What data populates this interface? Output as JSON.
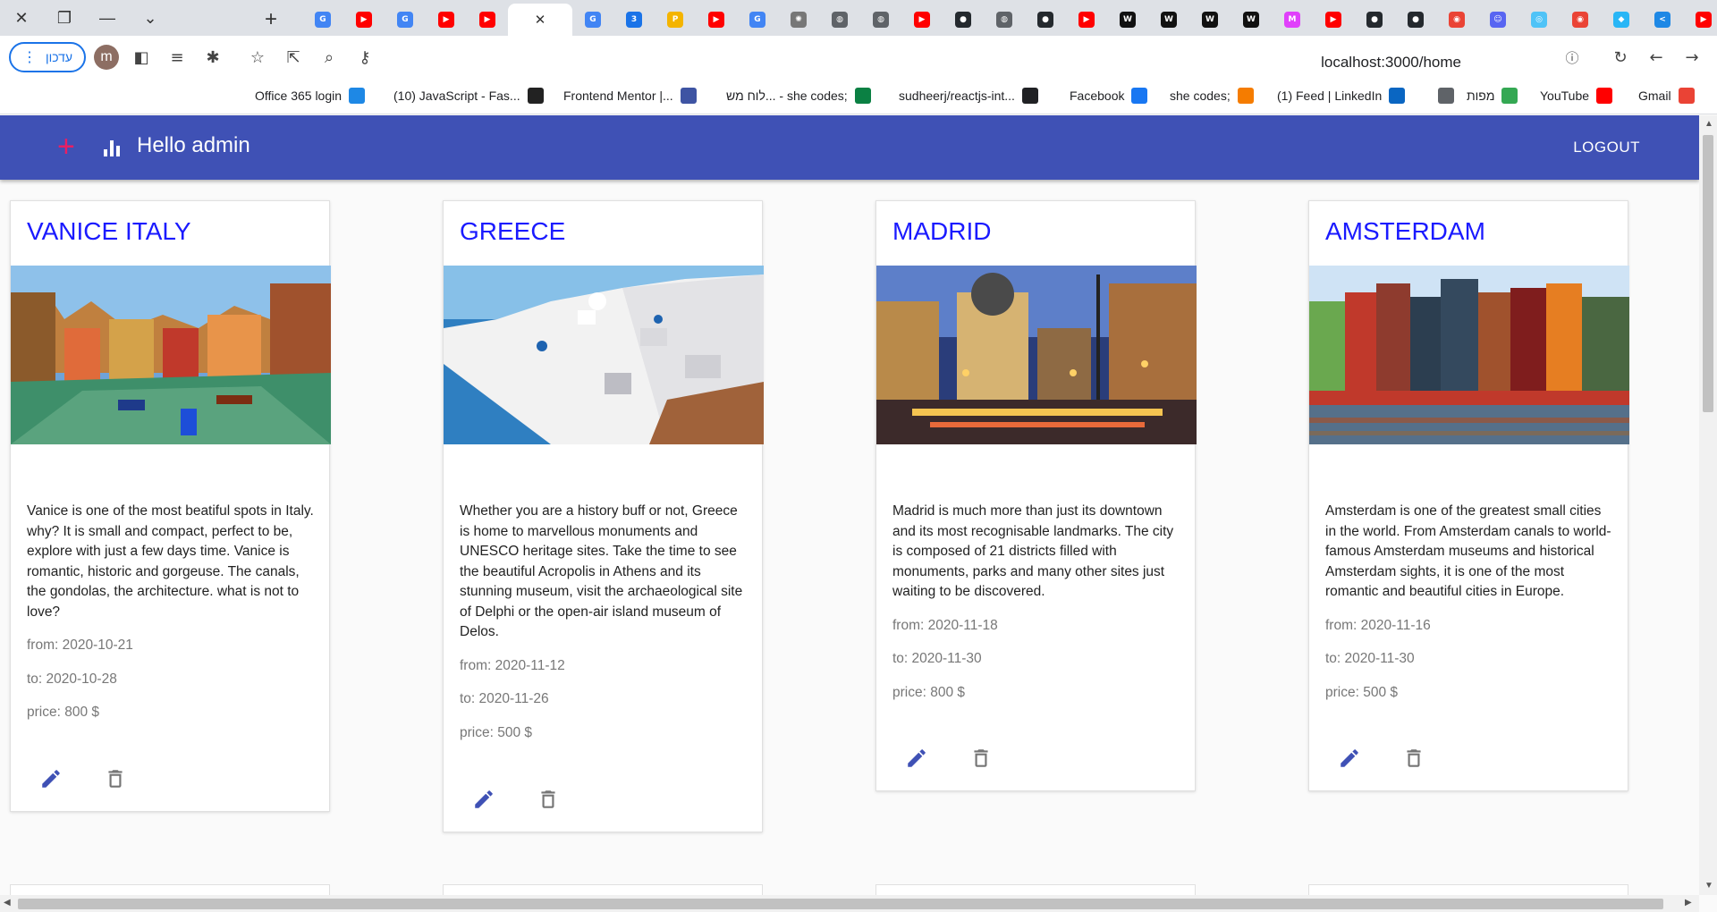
{
  "browser": {
    "url": "localhost:3000/home",
    "update_label": "עדכון",
    "profile_initial": "m",
    "tab_favicons": [
      "google",
      "youtube",
      "google",
      "youtube",
      "youtube",
      "close",
      "google",
      "calendar",
      "pma",
      "youtube",
      "google",
      "settings",
      "globe",
      "globe",
      "youtube",
      "github",
      "globe",
      "github",
      "youtube",
      "wix",
      "wix",
      "wix",
      "wix",
      "mg",
      "youtube",
      "github",
      "github",
      "chrome",
      "discord",
      "eye",
      "chrome",
      "tabler",
      "vscode",
      "youtube"
    ],
    "bookmarks": [
      {
        "label": "Gmail",
        "icon": "gmail-icon",
        "color": "#ea4335"
      },
      {
        "label": "YouTube",
        "icon": "youtube-icon",
        "color": "#ff0000"
      },
      {
        "label": "מפות",
        "icon": "maps-icon",
        "color": "#34a853"
      },
      {
        "label": "",
        "icon": "globe-icon",
        "color": "#5f6368"
      },
      {
        "label": "(1) Feed | LinkedIn",
        "icon": "linkedin-icon",
        "color": "#0a66c2"
      },
      {
        "label": "she codes;",
        "icon": "shecodes-icon",
        "color": "#f57c00"
      },
      {
        "label": "Facebook",
        "icon": "facebook-icon",
        "color": "#1877f2"
      },
      {
        "label": "sudheerj/reactjs-int...",
        "icon": "github-icon",
        "color": "#202124"
      },
      {
        "label": "לוח מש... - she codes;",
        "icon": "circle-icon",
        "color": "#0b8043"
      },
      {
        "label": "Frontend Mentor |...",
        "icon": "frontendmentor-icon",
        "color": "#3e54a3"
      },
      {
        "label": "(10) JavaScript - Fas...",
        "icon": "codewars-icon",
        "color": "#222"
      },
      {
        "label": "Office 365 login",
        "icon": "office-icon",
        "color": "#1e88e5"
      }
    ]
  },
  "app": {
    "greeting": "Hello admin",
    "logout_label": "LOGOUT",
    "accent_color": "#3f51b5",
    "add_color": "#e91e63"
  },
  "cards": [
    {
      "title": "VANICE ITALY",
      "description": "Vanice is one of the most beatiful spots in Italy. why? It is small and compact, perfect to be, explore with just a few days time. Vanice is romantic, historic and gorgeuse. The canals, the gondolas, the architecture. what is not to love?",
      "from": "from: 2020-10-21",
      "to": "to: 2020-10-28",
      "price": "price: 800 $"
    },
    {
      "title": "GREECE",
      "description": "Whether you are a history buff or not, Greece is home to marvellous monuments and UNESCO heritage sites. Take the time to see the beautiful Acropolis in Athens and its stunning museum, visit the archaeological site of Delphi or the open-air island museum of Delos.",
      "from": "from: 2020-11-12",
      "to": "to: 2020-11-26",
      "price": "price: 500 $"
    },
    {
      "title": "MADRID",
      "description": "Madrid is much more than just its downtown and its most recognisable landmarks. The city is composed of 21 districts filled with monuments, parks and many other sites just waiting to be discovered.",
      "from": "from: 2020-11-18",
      "to": "to: 2020-11-30",
      "price": "price: 800 $"
    },
    {
      "title": "AMSTERDAM",
      "description": "Amsterdam is one of the greatest small cities in the world. From Amsterdam canals to world-famous Amsterdam museums and historical Amsterdam sights, it is one of the most romantic and beautiful cities in Europe.",
      "from": "from: 2020-11-16",
      "to": "to: 2020-11-30",
      "price": "price: 500 $"
    }
  ]
}
